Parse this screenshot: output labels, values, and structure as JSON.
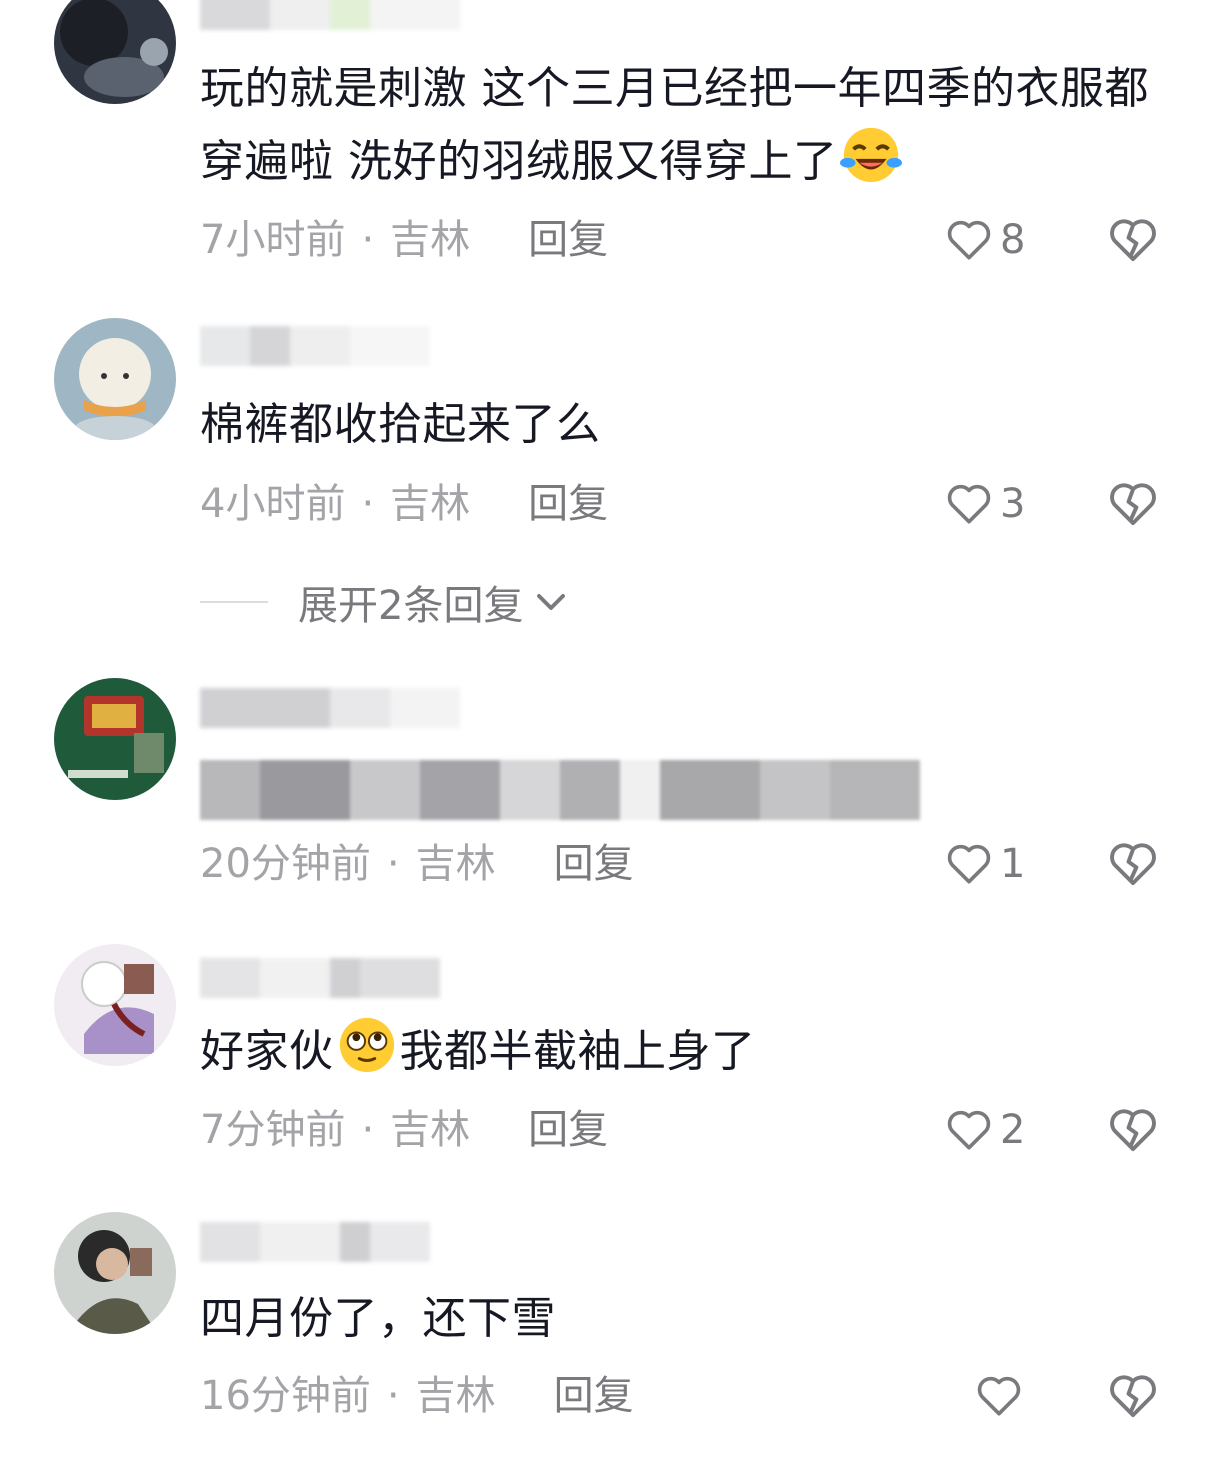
{
  "comments": [
    {
      "text": "玩的就是刺激 这个三月已经把一年四季的衣服都穿遍啦 洗好的羽绒服又得穿上了",
      "emoji": "laughing-crying-emoji",
      "time": "7小时前",
      "location": "吉林",
      "reply_label": "回复",
      "likes": "8"
    },
    {
      "text": "棉裤都收拾起来了么",
      "time": "4小时前",
      "location": "吉林",
      "reply_label": "回复",
      "likes": "3",
      "expand_label": "展开2条回复"
    },
    {
      "text": "",
      "time": "20分钟前",
      "location": "吉林",
      "reply_label": "回复",
      "likes": "1"
    },
    {
      "text_before": "好家伙",
      "emoji": "rolling-eyes-emoji",
      "text_after": "我都半截袖上身了",
      "time": "7分钟前",
      "location": "吉林",
      "reply_label": "回复",
      "likes": "2"
    },
    {
      "text": "四月份了，还下雪",
      "time": "16分钟前",
      "location": "吉林",
      "reply_label": "回复",
      "likes": ""
    }
  ],
  "separator": "·",
  "icons": {
    "like": "heart-outline-icon",
    "dislike": "broken-heart-icon",
    "expand": "chevron-down-icon"
  },
  "colors": {
    "text": "#161823",
    "meta": "#a4a4a8",
    "action": "#7a7a7e"
  }
}
